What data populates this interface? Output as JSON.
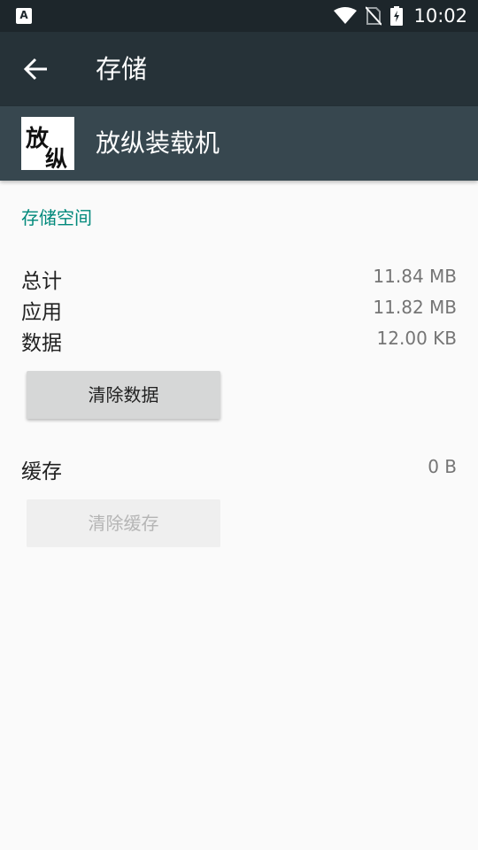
{
  "status_bar": {
    "time": "10:02",
    "notification_icon_letter": "A",
    "icons": [
      "wifi-icon",
      "no-sim-icon",
      "battery-charging-icon"
    ]
  },
  "app_bar": {
    "title": "存储",
    "back_icon": "arrow-left-icon"
  },
  "app_header": {
    "name": "放纵装载机",
    "icon_text": [
      "放",
      "纵"
    ]
  },
  "storage": {
    "section_title": "存储空间",
    "total_label": "总计",
    "total_value": "11.84 MB",
    "app_label": "应用",
    "app_value": "11.82 MB",
    "data_label": "数据",
    "data_value": "12.00 KB",
    "clear_data_button": "清除数据",
    "cache_label": "缓存",
    "cache_value": "0 B",
    "clear_cache_button": "清除缓存"
  },
  "colors": {
    "app_bar": "#263238",
    "header": "#37474f",
    "accent": "#00897b"
  }
}
